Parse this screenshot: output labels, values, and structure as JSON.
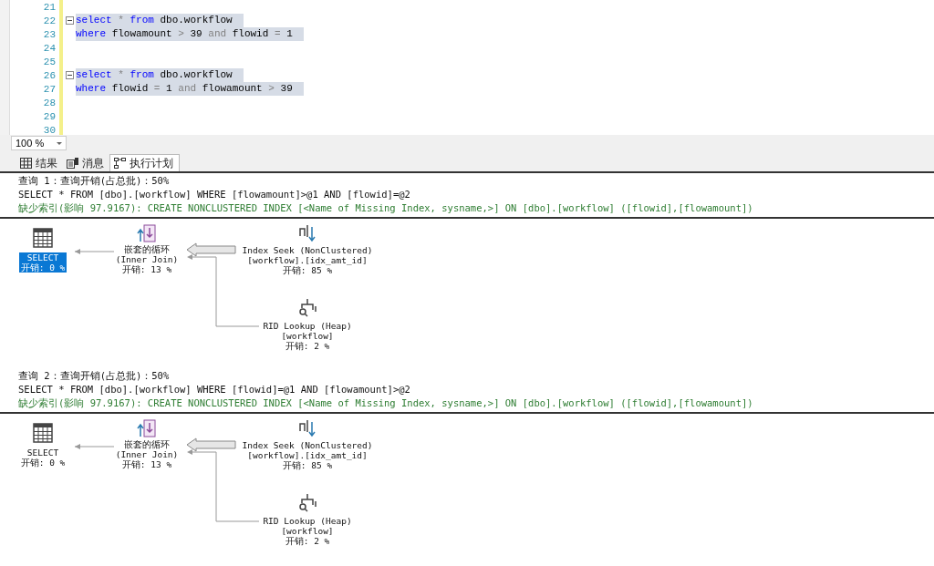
{
  "editor": {
    "lines": [
      {
        "number": "21",
        "collapsible": false
      },
      {
        "number": "22",
        "collapsible": true,
        "highlighted": true,
        "tokens": [
          {
            "text": "select",
            "kind": "keyword"
          },
          {
            "text": "*",
            "kind": "operator"
          },
          {
            "text": "from",
            "kind": "keyword"
          },
          {
            "text": "dbo.workflow",
            "kind": "ident"
          }
        ]
      },
      {
        "number": "23",
        "collapsible": false,
        "highlighted": true,
        "tokens": [
          {
            "text": "where",
            "kind": "keyword"
          },
          {
            "text": "flowamount",
            "kind": "ident"
          },
          {
            "text": ">",
            "kind": "operator"
          },
          {
            "text": "39",
            "kind": "ident"
          },
          {
            "text": "and",
            "kind": "operator"
          },
          {
            "text": "flowid",
            "kind": "ident"
          },
          {
            "text": "=",
            "kind": "operator"
          },
          {
            "text": "1",
            "kind": "ident"
          }
        ]
      },
      {
        "number": "24",
        "collapsible": false
      },
      {
        "number": "25",
        "collapsible": false
      },
      {
        "number": "26",
        "collapsible": true,
        "highlighted": true,
        "tokens": [
          {
            "text": "select",
            "kind": "keyword"
          },
          {
            "text": "*",
            "kind": "operator"
          },
          {
            "text": "from",
            "kind": "keyword"
          },
          {
            "text": "dbo.workflow",
            "kind": "ident"
          }
        ]
      },
      {
        "number": "27",
        "collapsible": false,
        "highlighted": true,
        "tokens": [
          {
            "text": "where",
            "kind": "keyword"
          },
          {
            "text": "flowid",
            "kind": "ident"
          },
          {
            "text": "=",
            "kind": "operator"
          },
          {
            "text": "1",
            "kind": "ident"
          },
          {
            "text": "and",
            "kind": "operator"
          },
          {
            "text": "flowamount",
            "kind": "ident"
          },
          {
            "text": ">",
            "kind": "operator"
          },
          {
            "text": "39",
            "kind": "ident"
          }
        ]
      },
      {
        "number": "28",
        "collapsible": false
      },
      {
        "number": "29",
        "collapsible": false
      },
      {
        "number": "30",
        "collapsible": false
      }
    ],
    "zoom": "100 %"
  },
  "tabs": [
    {
      "label": "结果",
      "kind": "grid",
      "selected": false
    },
    {
      "label": "消息",
      "kind": "messages",
      "selected": false
    },
    {
      "label": "执行计划",
      "kind": "plan",
      "selected": true
    }
  ],
  "queries": [
    {
      "header": "查询 1：查询开销(占总批)：50%",
      "sql": "SELECT * FROM [dbo].[workflow] WHERE [flowamount]>@1 AND [flowid]=@2",
      "missing_index": "缺少索引(影响 97.9167): CREATE NONCLUSTERED INDEX [<Name of Missing Index, sysname,>] ON [dbo].[workflow] ([flowid],[flowamount])",
      "nodes": [
        {
          "kind": "select",
          "selected": true,
          "lines": [
            "SELECT",
            "开销: 0 %"
          ]
        },
        {
          "kind": "nested_loops",
          "selected": false,
          "lines": [
            "嵌套的循环",
            "(Inner Join)",
            "开销: 13 %"
          ]
        },
        {
          "kind": "index_seek",
          "selected": false,
          "lines": [
            "Index Seek (NonClustered)",
            "[workflow].[idx_amt_id]",
            "开销: 85 %"
          ]
        },
        {
          "kind": "rid_lookup",
          "selected": false,
          "lines": [
            "RID Lookup (Heap)",
            "[workflow]",
            "开销: 2 %"
          ]
        }
      ]
    },
    {
      "header": "查询 2：查询开销(占总批)：50%",
      "sql": "SELECT * FROM [dbo].[workflow] WHERE [flowid]=@1 AND [flowamount]>@2",
      "missing_index": "缺少索引(影响 97.9167): CREATE NONCLUSTERED INDEX [<Name of Missing Index, sysname,>] ON [dbo].[workflow] ([flowid],[flowamount])",
      "nodes": [
        {
          "kind": "select",
          "selected": false,
          "lines": [
            "SELECT",
            "开销: 0 %"
          ]
        },
        {
          "kind": "nested_loops",
          "selected": false,
          "lines": [
            "嵌套的循环",
            "(Inner Join)",
            "开销: 13 %"
          ]
        },
        {
          "kind": "index_seek",
          "selected": false,
          "lines": [
            "Index Seek (NonClustered)",
            "[workflow].[idx_amt_id]",
            "开销: 85 %"
          ]
        },
        {
          "kind": "rid_lookup",
          "selected": false,
          "lines": [
            "RID Lookup (Heap)",
            "[workflow]",
            "开销: 2 %"
          ]
        }
      ]
    }
  ]
}
